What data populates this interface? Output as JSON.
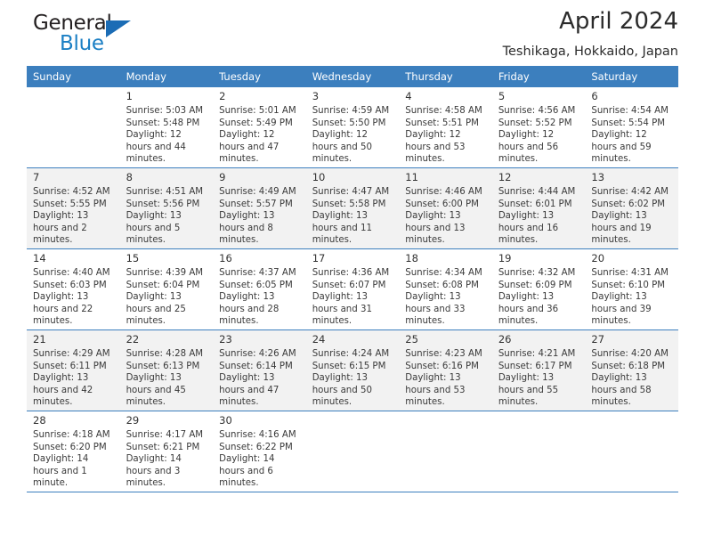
{
  "brand": {
    "name_top": "General",
    "name_bottom": "Blue",
    "triangle_color": "#1b6cb5",
    "blue_color": "#1b7fc4"
  },
  "header": {
    "title": "April 2024",
    "subtitle": "Teshikaga, Hokkaido, Japan"
  },
  "theme": {
    "header_bg": "#3c7fbe",
    "row_shade": "#f2f2f2",
    "row_plain": "#ffffff",
    "text": "#3a3a3a"
  },
  "calendar": {
    "weekdays": [
      "Sunday",
      "Monday",
      "Tuesday",
      "Wednesday",
      "Thursday",
      "Friday",
      "Saturday"
    ],
    "weeks": [
      [
        {
          "day": "",
          "sunrise": "",
          "sunset": "",
          "daylight": ""
        },
        {
          "day": "1",
          "sunrise": "Sunrise: 5:03 AM",
          "sunset": "Sunset: 5:48 PM",
          "daylight": "Daylight: 12 hours and 44 minutes."
        },
        {
          "day": "2",
          "sunrise": "Sunrise: 5:01 AM",
          "sunset": "Sunset: 5:49 PM",
          "daylight": "Daylight: 12 hours and 47 minutes."
        },
        {
          "day": "3",
          "sunrise": "Sunrise: 4:59 AM",
          "sunset": "Sunset: 5:50 PM",
          "daylight": "Daylight: 12 hours and 50 minutes."
        },
        {
          "day": "4",
          "sunrise": "Sunrise: 4:58 AM",
          "sunset": "Sunset: 5:51 PM",
          "daylight": "Daylight: 12 hours and 53 minutes."
        },
        {
          "day": "5",
          "sunrise": "Sunrise: 4:56 AM",
          "sunset": "Sunset: 5:52 PM",
          "daylight": "Daylight: 12 hours and 56 minutes."
        },
        {
          "day": "6",
          "sunrise": "Sunrise: 4:54 AM",
          "sunset": "Sunset: 5:54 PM",
          "daylight": "Daylight: 12 hours and 59 minutes."
        }
      ],
      [
        {
          "day": "7",
          "sunrise": "Sunrise: 4:52 AM",
          "sunset": "Sunset: 5:55 PM",
          "daylight": "Daylight: 13 hours and 2 minutes."
        },
        {
          "day": "8",
          "sunrise": "Sunrise: 4:51 AM",
          "sunset": "Sunset: 5:56 PM",
          "daylight": "Daylight: 13 hours and 5 minutes."
        },
        {
          "day": "9",
          "sunrise": "Sunrise: 4:49 AM",
          "sunset": "Sunset: 5:57 PM",
          "daylight": "Daylight: 13 hours and 8 minutes."
        },
        {
          "day": "10",
          "sunrise": "Sunrise: 4:47 AM",
          "sunset": "Sunset: 5:58 PM",
          "daylight": "Daylight: 13 hours and 11 minutes."
        },
        {
          "day": "11",
          "sunrise": "Sunrise: 4:46 AM",
          "sunset": "Sunset: 6:00 PM",
          "daylight": "Daylight: 13 hours and 13 minutes."
        },
        {
          "day": "12",
          "sunrise": "Sunrise: 4:44 AM",
          "sunset": "Sunset: 6:01 PM",
          "daylight": "Daylight: 13 hours and 16 minutes."
        },
        {
          "day": "13",
          "sunrise": "Sunrise: 4:42 AM",
          "sunset": "Sunset: 6:02 PM",
          "daylight": "Daylight: 13 hours and 19 minutes."
        }
      ],
      [
        {
          "day": "14",
          "sunrise": "Sunrise: 4:40 AM",
          "sunset": "Sunset: 6:03 PM",
          "daylight": "Daylight: 13 hours and 22 minutes."
        },
        {
          "day": "15",
          "sunrise": "Sunrise: 4:39 AM",
          "sunset": "Sunset: 6:04 PM",
          "daylight": "Daylight: 13 hours and 25 minutes."
        },
        {
          "day": "16",
          "sunrise": "Sunrise: 4:37 AM",
          "sunset": "Sunset: 6:05 PM",
          "daylight": "Daylight: 13 hours and 28 minutes."
        },
        {
          "day": "17",
          "sunrise": "Sunrise: 4:36 AM",
          "sunset": "Sunset: 6:07 PM",
          "daylight": "Daylight: 13 hours and 31 minutes."
        },
        {
          "day": "18",
          "sunrise": "Sunrise: 4:34 AM",
          "sunset": "Sunset: 6:08 PM",
          "daylight": "Daylight: 13 hours and 33 minutes."
        },
        {
          "day": "19",
          "sunrise": "Sunrise: 4:32 AM",
          "sunset": "Sunset: 6:09 PM",
          "daylight": "Daylight: 13 hours and 36 minutes."
        },
        {
          "day": "20",
          "sunrise": "Sunrise: 4:31 AM",
          "sunset": "Sunset: 6:10 PM",
          "daylight": "Daylight: 13 hours and 39 minutes."
        }
      ],
      [
        {
          "day": "21",
          "sunrise": "Sunrise: 4:29 AM",
          "sunset": "Sunset: 6:11 PM",
          "daylight": "Daylight: 13 hours and 42 minutes."
        },
        {
          "day": "22",
          "sunrise": "Sunrise: 4:28 AM",
          "sunset": "Sunset: 6:13 PM",
          "daylight": "Daylight: 13 hours and 45 minutes."
        },
        {
          "day": "23",
          "sunrise": "Sunrise: 4:26 AM",
          "sunset": "Sunset: 6:14 PM",
          "daylight": "Daylight: 13 hours and 47 minutes."
        },
        {
          "day": "24",
          "sunrise": "Sunrise: 4:24 AM",
          "sunset": "Sunset: 6:15 PM",
          "daylight": "Daylight: 13 hours and 50 minutes."
        },
        {
          "day": "25",
          "sunrise": "Sunrise: 4:23 AM",
          "sunset": "Sunset: 6:16 PM",
          "daylight": "Daylight: 13 hours and 53 minutes."
        },
        {
          "day": "26",
          "sunrise": "Sunrise: 4:21 AM",
          "sunset": "Sunset: 6:17 PM",
          "daylight": "Daylight: 13 hours and 55 minutes."
        },
        {
          "day": "27",
          "sunrise": "Sunrise: 4:20 AM",
          "sunset": "Sunset: 6:18 PM",
          "daylight": "Daylight: 13 hours and 58 minutes."
        }
      ],
      [
        {
          "day": "28",
          "sunrise": "Sunrise: 4:18 AM",
          "sunset": "Sunset: 6:20 PM",
          "daylight": "Daylight: 14 hours and 1 minute."
        },
        {
          "day": "29",
          "sunrise": "Sunrise: 4:17 AM",
          "sunset": "Sunset: 6:21 PM",
          "daylight": "Daylight: 14 hours and 3 minutes."
        },
        {
          "day": "30",
          "sunrise": "Sunrise: 4:16 AM",
          "sunset": "Sunset: 6:22 PM",
          "daylight": "Daylight: 14 hours and 6 minutes."
        },
        {
          "day": "",
          "sunrise": "",
          "sunset": "",
          "daylight": ""
        },
        {
          "day": "",
          "sunrise": "",
          "sunset": "",
          "daylight": ""
        },
        {
          "day": "",
          "sunrise": "",
          "sunset": "",
          "daylight": ""
        },
        {
          "day": "",
          "sunrise": "",
          "sunset": "",
          "daylight": ""
        }
      ]
    ]
  }
}
